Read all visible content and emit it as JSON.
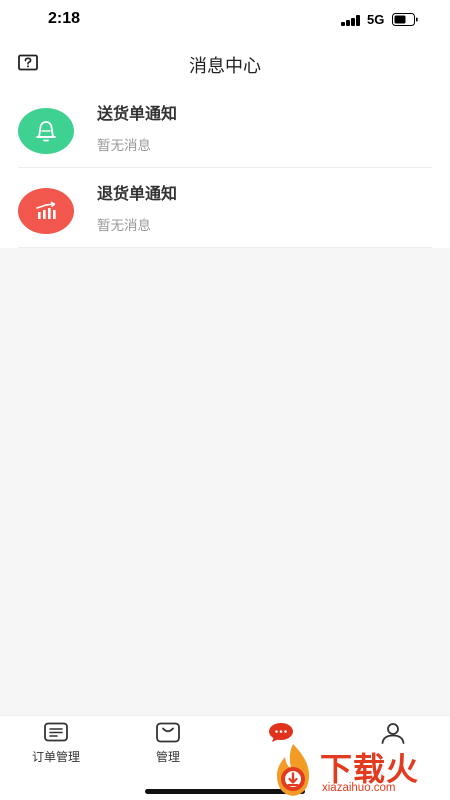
{
  "status_bar": {
    "time": "2:18",
    "network": "5G",
    "icons": [
      "signal-icon",
      "battery-icon"
    ]
  },
  "header": {
    "title": "消息中心",
    "left_icon": "help-icon"
  },
  "messages": [
    {
      "title": "送货单通知",
      "subtitle": "暂无消息",
      "icon": "bell-icon",
      "color": "#3ed191"
    },
    {
      "title": "退货单通知",
      "subtitle": "暂无消息",
      "icon": "bar-chart-icon",
      "color": "#f1574c"
    }
  ],
  "tabbar": {
    "items": [
      {
        "label": "订单管理",
        "icon": "order-list-icon"
      },
      {
        "label": "管理",
        "icon": "bag-icon"
      },
      {
        "label": "",
        "icon": "message-icon",
        "active": true,
        "active_color": "#e0321c"
      },
      {
        "label": "",
        "icon": "user-icon"
      }
    ]
  },
  "watermark": {
    "text": "下载火",
    "domain": "xiazaihuo.com"
  }
}
